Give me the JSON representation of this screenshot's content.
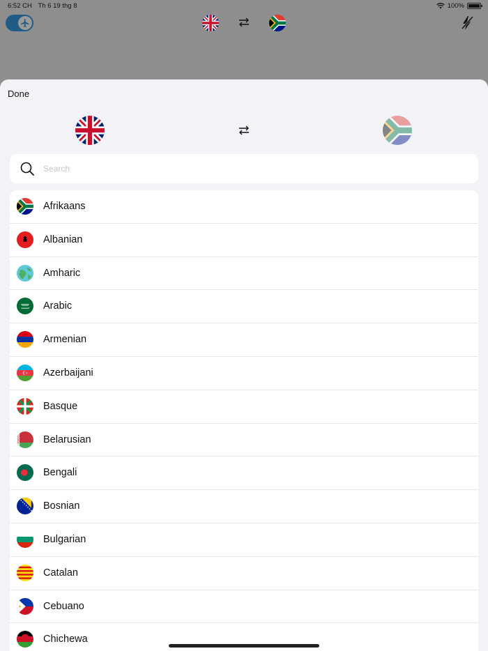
{
  "status_bar": {
    "time": "6:52 CH",
    "date": "Th 6 19 thg 8",
    "battery_percent": "100%",
    "battery_level": 1.0
  },
  "toolbar": {
    "offline_toggle_on": true,
    "source_flag": "flag-united-kingdom",
    "target_flag": "flag-south-africa",
    "swap_icon": "swap-arrows-icon",
    "flash_icon": "flash-off-icon"
  },
  "sheet": {
    "done_label": "Done",
    "source_flag": "flag-united-kingdom",
    "target_flag": "flag-south-africa",
    "search": {
      "placeholder": "Search",
      "value": ""
    },
    "languages": [
      {
        "name": "Afrikaans",
        "flag": "flag-south-africa"
      },
      {
        "name": "Albanian",
        "flag": "flag-albania"
      },
      {
        "name": "Amharic",
        "flag": "globe"
      },
      {
        "name": "Arabic",
        "flag": "flag-saudi-arabia"
      },
      {
        "name": "Armenian",
        "flag": "flag-armenia"
      },
      {
        "name": "Azerbaijani",
        "flag": "flag-azerbaijan"
      },
      {
        "name": "Basque",
        "flag": "flag-basque"
      },
      {
        "name": "Belarusian",
        "flag": "flag-belarus"
      },
      {
        "name": "Bengali",
        "flag": "flag-bangladesh"
      },
      {
        "name": "Bosnian",
        "flag": "flag-bosnia"
      },
      {
        "name": "Bulgarian",
        "flag": "flag-bulgaria"
      },
      {
        "name": "Catalan",
        "flag": "flag-catalonia"
      },
      {
        "name": "Cebuano",
        "flag": "flag-philippines"
      },
      {
        "name": "Chichewa",
        "flag": "flag-malawi"
      }
    ]
  },
  "colors": {
    "accent": "#1f5c86",
    "overlay": "#8e8e8e",
    "sheet_bg": "#f2f2f7"
  }
}
